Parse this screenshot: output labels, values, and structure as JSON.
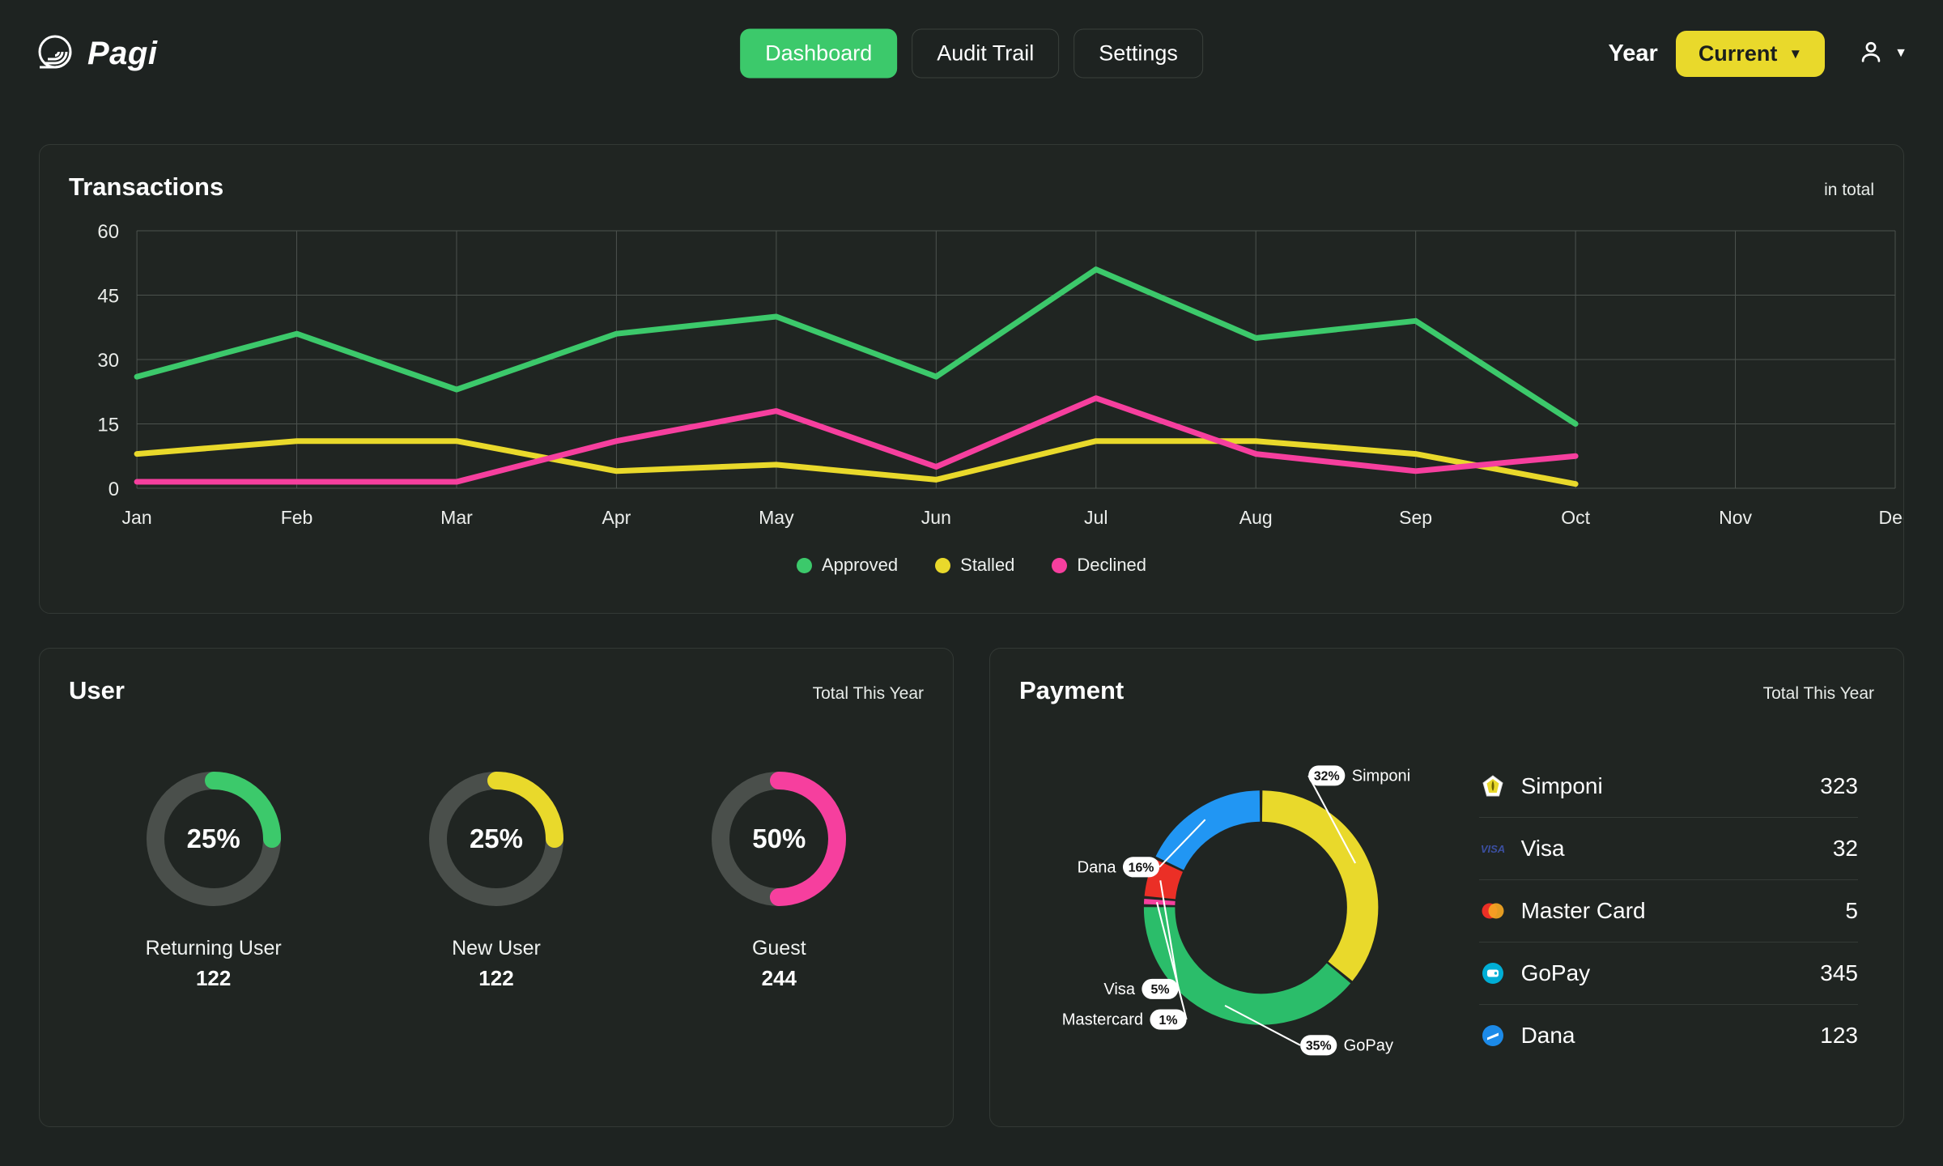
{
  "brand": {
    "name": "Pagi",
    "logo_icon": "spiral-fingerprint-icon"
  },
  "nav": {
    "items": [
      {
        "label": "Dashboard",
        "active": true
      },
      {
        "label": "Audit Trail",
        "active": false
      },
      {
        "label": "Settings",
        "active": false
      }
    ]
  },
  "header_right": {
    "year_label": "Year",
    "year_value": "Current",
    "caret": "▼",
    "account_icon": "user-avatar-icon",
    "account_caret": "▼"
  },
  "transactions": {
    "title": "Transactions",
    "subtitle": "in total"
  },
  "user_card": {
    "title": "User",
    "subtitle": "Total This Year",
    "gauges": [
      {
        "label": "Returning User",
        "percent": "25%",
        "value": "122",
        "pct_num": 25,
        "color": "#3cc96b"
      },
      {
        "label": "New User",
        "percent": "25%",
        "value": "122",
        "pct_num": 25,
        "color": "#e9d92b"
      },
      {
        "label": "Guest",
        "percent": "50%",
        "value": "244",
        "pct_num": 50,
        "color": "#f63f9e"
      }
    ],
    "track_color": "#4a4f4b"
  },
  "payment_card": {
    "title": "Payment",
    "subtitle": "Total This Year",
    "list": [
      {
        "name": "Simponi",
        "count": "323",
        "icon": "simponi-logo-icon",
        "color": "#e9d92b"
      },
      {
        "name": "Visa",
        "count": "32",
        "icon": "visa-logo-icon",
        "color": "#3b4fa0"
      },
      {
        "name": "Master Card",
        "count": "5",
        "icon": "mastercard-logo-icon",
        "color": "#eb2f26"
      },
      {
        "name": "GoPay",
        "count": "345",
        "icon": "gopay-logo-icon",
        "color": "#00aed6"
      },
      {
        "name": "Dana",
        "count": "123",
        "icon": "dana-logo-icon",
        "color": "#1c8ae8"
      }
    ]
  },
  "chart_data": [
    {
      "type": "line",
      "title": "Transactions",
      "subtitle": "in total",
      "xlabel": "",
      "ylabel": "",
      "categories": [
        "Jan",
        "Feb",
        "Mar",
        "Apr",
        "May",
        "Jun",
        "Jul",
        "Aug",
        "Sep",
        "Oct",
        "Nov",
        "Dec"
      ],
      "ylim": [
        0,
        60
      ],
      "yticks": [
        0,
        15,
        30,
        45,
        60
      ],
      "grid": true,
      "legend_position": "bottom",
      "series": [
        {
          "name": "Approved",
          "color": "#3cc96b",
          "values": [
            26,
            36,
            23,
            36,
            40,
            26,
            51,
            35,
            39,
            15,
            null,
            null
          ]
        },
        {
          "name": "Stalled",
          "color": "#e9d92b",
          "values": [
            8,
            11,
            11,
            4,
            5.5,
            2,
            11,
            11,
            8,
            1,
            null,
            null
          ]
        },
        {
          "name": "Declined",
          "color": "#f63f9e",
          "values": [
            1.5,
            1.5,
            1.5,
            11,
            18,
            5,
            21,
            8,
            4,
            7.5,
            null,
            null
          ]
        }
      ]
    },
    {
      "type": "pie",
      "title": "Payment",
      "subtitle": "Total This Year",
      "labels": [
        "Simponi",
        "GoPay",
        "Mastercard",
        "Visa",
        "Dana"
      ],
      "values": [
        32,
        35,
        1,
        5,
        16
      ],
      "display_percents": [
        "32%",
        "35%",
        "1%",
        "5%",
        "16%"
      ],
      "colors": [
        "#e9d92b",
        "#2bbd6a",
        "#f63f9e",
        "#eb2f26",
        "#2196f3"
      ],
      "counts": [
        323,
        345,
        5,
        32,
        123
      ],
      "legend_position": "right"
    }
  ]
}
